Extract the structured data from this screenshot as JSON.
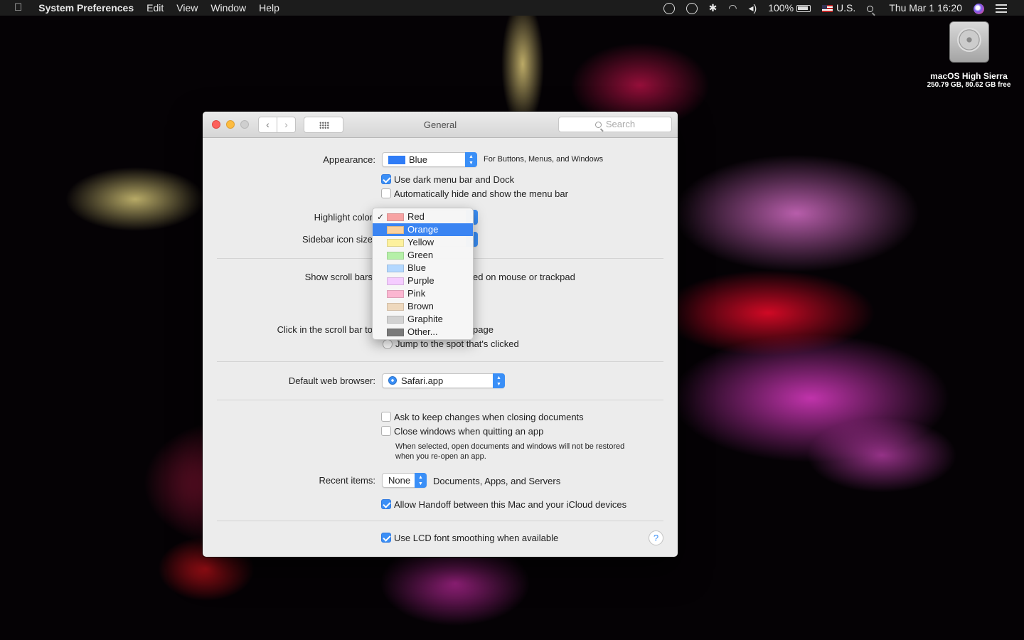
{
  "menubar": {
    "app_name": "System Preferences",
    "menus": [
      "Edit",
      "View",
      "Window",
      "Help"
    ],
    "battery": "100%",
    "input_source": "U.S.",
    "clock": "Thu Mar 1  16:20"
  },
  "desktop": {
    "disk_name": "macOS High Sierra",
    "disk_info": "250.79 GB, 80.62 GB free"
  },
  "window": {
    "title": "General",
    "search_placeholder": "Search",
    "appearance": {
      "label": "Appearance:",
      "value": "Blue",
      "swatch": "#2f7cf6",
      "note": "For Buttons, Menus, and Windows"
    },
    "dark_menu": {
      "label": "Use dark menu bar and Dock",
      "checked": true
    },
    "auto_hide": {
      "label": "Automatically hide and show the menu bar",
      "checked": false
    },
    "highlight_label": "Highlight color",
    "sidebar_label": "Sidebar icon size",
    "show_scroll_label": "Show scroll bars",
    "show_scroll_tail": "ed on mouse or trackpad",
    "click_scroll_label": "Click in the scroll bar to",
    "click_scroll_tail": "page",
    "jump_spot": "Jump to the spot that's clicked",
    "browser": {
      "label": "Default web browser:",
      "value": "Safari.app"
    },
    "ask_keep": {
      "label": "Ask to keep changes when closing documents",
      "checked": false
    },
    "close_windows": {
      "label": "Close windows when quitting an app",
      "checked": false
    },
    "close_note_1": "When selected, open documents and windows will not be restored",
    "close_note_2": "when you re-open an app.",
    "recent": {
      "label": "Recent items:",
      "value": "None",
      "tail": "Documents, Apps, and Servers"
    },
    "handoff": {
      "label": "Allow Handoff between this Mac and your iCloud devices",
      "checked": true
    },
    "lcd": {
      "label": "Use LCD font smoothing when available",
      "checked": true
    },
    "help": "?"
  },
  "highlight_menu": {
    "checked_item": "Red",
    "selected_item": "Orange",
    "items": [
      {
        "label": "Red",
        "color": "#f7a3a3"
      },
      {
        "label": "Orange",
        "color": "#fbd19d"
      },
      {
        "label": "Yellow",
        "color": "#fdf19e"
      },
      {
        "label": "Green",
        "color": "#b5f0a8"
      },
      {
        "label": "Blue",
        "color": "#b3d8ff"
      },
      {
        "label": "Purple",
        "color": "#f5ccff"
      },
      {
        "label": "Pink",
        "color": "#fbb6d1"
      },
      {
        "label": "Brown",
        "color": "#eed8bd"
      },
      {
        "label": "Graphite",
        "color": "#d2d2d2"
      },
      {
        "label": "Other...",
        "color": "#7a7a7a"
      }
    ]
  }
}
